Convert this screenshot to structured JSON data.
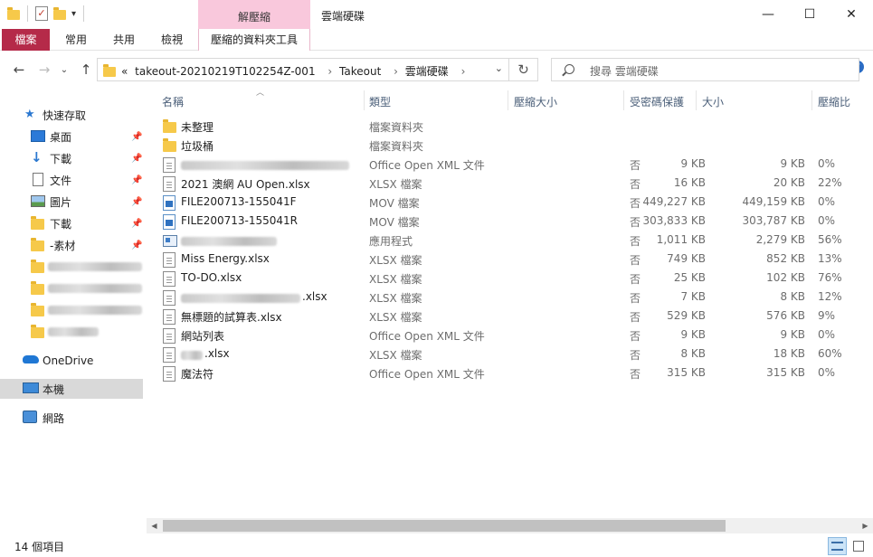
{
  "window": {
    "title": "雲端硬碟",
    "context_tab_header": "解壓縮",
    "controls": {
      "minimize": "—",
      "maximize": "☐",
      "close": "✕"
    }
  },
  "ribbon": {
    "tabs": [
      "檔案",
      "常用",
      "共用",
      "檢視",
      "壓縮的資料夾工具"
    ],
    "collapse_glyph": "⌄",
    "help_glyph": "?"
  },
  "address": {
    "overflow": "«",
    "crumbs": [
      "takeout-20210219T102254Z-001",
      "Takeout",
      "雲端硬碟"
    ],
    "separator": "›"
  },
  "search": {
    "placeholder": "搜尋 雲端硬碟"
  },
  "sidebar": {
    "quick_access": "快速存取",
    "pinned": [
      {
        "label": "桌面",
        "icon": "desktop-icon"
      },
      {
        "label": "下載",
        "icon": "download-icon"
      },
      {
        "label": "文件",
        "icon": "documents-icon"
      },
      {
        "label": "圖片",
        "icon": "pictures-icon"
      },
      {
        "label": "下載",
        "icon": "folder-icon"
      },
      {
        "label": "-素材",
        "icon": "folder-icon"
      }
    ],
    "onedrive": "OneDrive",
    "this_pc": "本機",
    "network": "網路"
  },
  "columns": [
    "名稱",
    "類型",
    "壓縮大小",
    "受密碼保護",
    "大小",
    "壓縮比"
  ],
  "files": [
    {
      "name": "未整理",
      "type": "檔案資料夾",
      "csize": "",
      "pwd": "",
      "size": "",
      "ratio": "",
      "icon": "folder"
    },
    {
      "name": "垃圾桶",
      "type": "檔案資料夾",
      "csize": "",
      "pwd": "",
      "size": "",
      "ratio": "",
      "icon": "folder"
    },
    {
      "name": "",
      "type": "Office Open XML 文件",
      "csize": "9 KB",
      "pwd": "否",
      "size": "9 KB",
      "ratio": "0%",
      "icon": "doc"
    },
    {
      "name": "2021 澳網 AU Open.xlsx",
      "type": "XLSX 檔案",
      "csize": "16 KB",
      "pwd": "否",
      "size": "20 KB",
      "ratio": "22%",
      "icon": "doc"
    },
    {
      "name": "FILE200713-155041F",
      "type": "MOV 檔案",
      "csize": "449,227 KB",
      "pwd": "否",
      "size": "449,159 KB",
      "ratio": "0%",
      "icon": "mov"
    },
    {
      "name": "FILE200713-155041R",
      "type": "MOV 檔案",
      "csize": "303,833 KB",
      "pwd": "否",
      "size": "303,787 KB",
      "ratio": "0%",
      "icon": "mov"
    },
    {
      "name": "",
      "type": "應用程式",
      "csize": "1,011 KB",
      "pwd": "否",
      "size": "2,279 KB",
      "ratio": "56%",
      "icon": "app"
    },
    {
      "name": "Miss Energy.xlsx",
      "type": "XLSX 檔案",
      "csize": "749 KB",
      "pwd": "否",
      "size": "852 KB",
      "ratio": "13%",
      "icon": "doc"
    },
    {
      "name": "TO-DO.xlsx",
      "type": "XLSX 檔案",
      "csize": "25 KB",
      "pwd": "否",
      "size": "102 KB",
      "ratio": "76%",
      "icon": "doc"
    },
    {
      "name": ".xlsx",
      "type": "XLSX 檔案",
      "csize": "7 KB",
      "pwd": "否",
      "size": "8 KB",
      "ratio": "12%",
      "icon": "doc"
    },
    {
      "name": "無標題的試算表.xlsx",
      "type": "XLSX 檔案",
      "csize": "529 KB",
      "pwd": "否",
      "size": "576 KB",
      "ratio": "9%",
      "icon": "doc"
    },
    {
      "name": "網站列表",
      "type": "Office Open XML 文件",
      "csize": "9 KB",
      "pwd": "否",
      "size": "9 KB",
      "ratio": "0%",
      "icon": "doc"
    },
    {
      "name": ".xlsx",
      "type": "XLSX 檔案",
      "csize": "8 KB",
      "pwd": "否",
      "size": "18 KB",
      "ratio": "60%",
      "icon": "doc"
    },
    {
      "name": "魔法符",
      "type": "Office Open XML 文件",
      "csize": "315 KB",
      "pwd": "否",
      "size": "315 KB",
      "ratio": "0%",
      "icon": "doc"
    }
  ],
  "status": {
    "count": "14 個項目"
  }
}
